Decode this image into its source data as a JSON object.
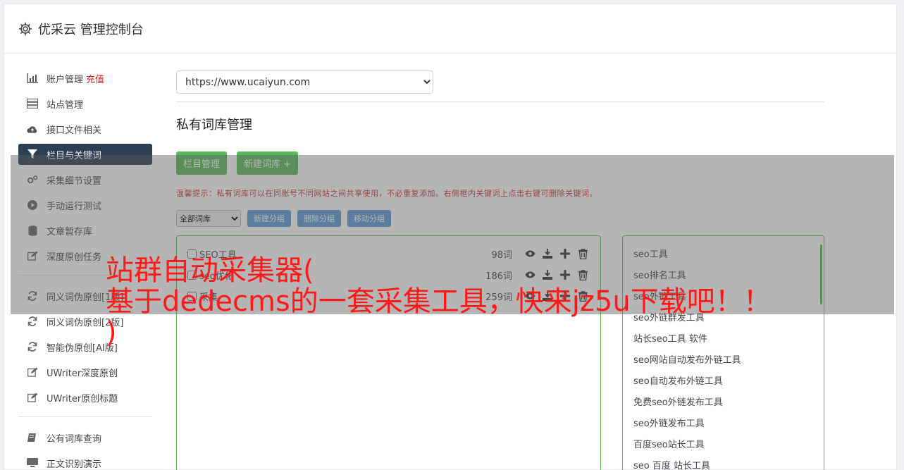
{
  "header": {
    "title": "优采云 管理控制台",
    "icon": "gear-icon"
  },
  "sidebar": {
    "items": [
      {
        "icon": "bar-chart-icon",
        "label": "账户管理",
        "badge": "充值",
        "active": false
      },
      {
        "icon": "server-icon",
        "label": "站点管理",
        "active": false
      },
      {
        "icon": "cloud-upload-icon",
        "label": "接口文件相关",
        "active": false
      },
      {
        "icon": "filter-icon",
        "label": "栏目与关键词",
        "active": true
      },
      {
        "icon": "cogs-icon",
        "label": "采集细节设置",
        "active": false
      },
      {
        "icon": "play-circle-icon",
        "label": "手动运行测试",
        "active": false
      },
      {
        "icon": "database-icon",
        "label": "文章暂存库",
        "active": false
      },
      {
        "icon": "edit-icon",
        "label": "深度原创任务",
        "active": false
      }
    ],
    "items2": [
      {
        "icon": "refresh-icon",
        "label": "同义词伪原创[1版]"
      },
      {
        "icon": "refresh-icon",
        "label": "同义词伪原创[2版]"
      },
      {
        "icon": "refresh-icon",
        "label": "智能伪原创[AI版]"
      },
      {
        "icon": "edit-icon",
        "label": "UWriter深度原创"
      },
      {
        "icon": "edit-icon",
        "label": "UWriter原创标题"
      }
    ],
    "items3": [
      {
        "icon": "book-icon",
        "label": "公有词库查询"
      },
      {
        "icon": "monitor-icon",
        "label": "正文识别演示"
      }
    ]
  },
  "main": {
    "site_select": "https://www.ucaiyun.com",
    "section_title": "私有词库管理",
    "btn_column": "栏目管理",
    "btn_new_lib": "新建词库 +",
    "tip": "温馨提示：私有词库可以在同账号不同网站之间共享使用，不必重复添加。右侧框内关键词上点击右键可删除关键词。",
    "group_select": "全部词库",
    "btn_new_group": "新建分组",
    "btn_delete_group": "删除分组",
    "btn_move_group": "移动分组",
    "libraries": [
      {
        "name": "SEO工具",
        "count": "98词"
      },
      {
        "name": "seo优化",
        "count": "186词"
      },
      {
        "name": "采集",
        "count": "259词"
      }
    ],
    "keywords": [
      "seo工具",
      "seo排名工具",
      "seo外链工具",
      "seo外链群发工具",
      "站长seo工具 软件",
      "seo网站自动发布外链工具",
      "seo自动发布外链工具",
      "免费seo外链发布工具",
      "seo外链发布工具",
      "百度seo站长工具",
      "seo 百度 站长工具"
    ]
  },
  "watermark": {
    "line1": "站群自动采集器(",
    "line2": "基于dedecms的一套采集工具，快来jz5u下载吧！！",
    "line3": ")"
  },
  "colors": {
    "accent_green": "#5cb85c",
    "accent_blue": "#5b9bd5",
    "active_nav": "#2d3f55",
    "warning": "#c9302c"
  }
}
